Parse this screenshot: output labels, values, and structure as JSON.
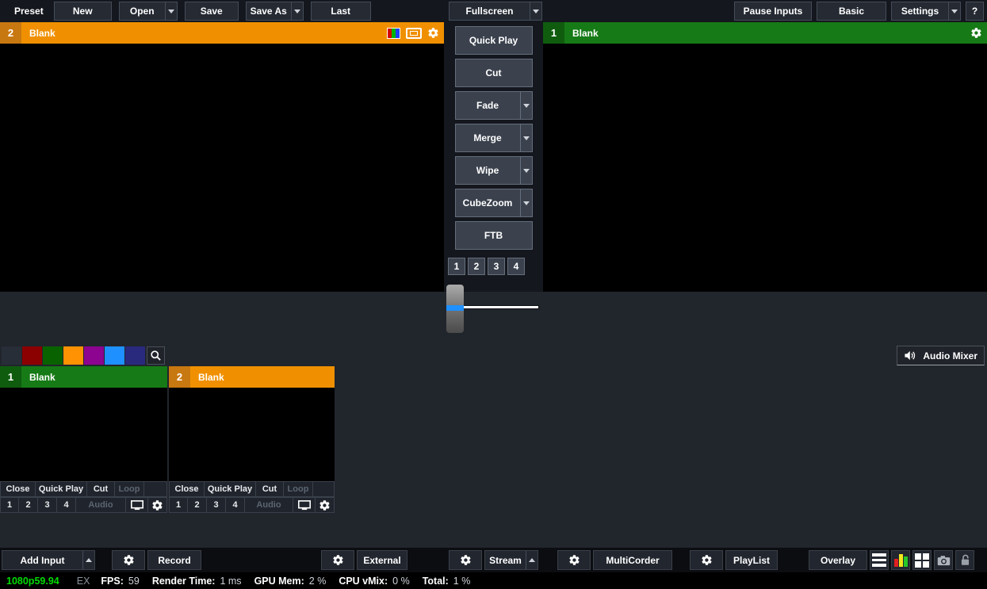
{
  "top_toolbar": {
    "preset_label": "Preset",
    "new": "New",
    "open": "Open",
    "save": "Save",
    "save_as": "Save As",
    "last": "Last",
    "fullscreen": "Fullscreen",
    "pause_inputs": "Pause Inputs",
    "basic": "Basic",
    "settings": "Settings",
    "help": "?"
  },
  "preview": {
    "number": "2",
    "title": "Blank"
  },
  "program": {
    "number": "1",
    "title": "Blank"
  },
  "transitions": {
    "quick_play": "Quick Play",
    "cut": "Cut",
    "fade": "Fade",
    "merge": "Merge",
    "wipe": "Wipe",
    "cube_zoom": "CubeZoom",
    "ftb": "FTB",
    "stingers": [
      "1",
      "2",
      "3",
      "4"
    ]
  },
  "color_filter": {
    "swatches": [
      "#272E37",
      "#8B0000",
      "#096200",
      "#FF9202",
      "#8C0490",
      "#1E90FF",
      "#29297E"
    ]
  },
  "audio_mixer_label": "Audio Mixer",
  "inputs": [
    {
      "number": "1",
      "title": "Blank",
      "close": "Close",
      "quick_play": "Quick Play",
      "cut": "Cut",
      "loop": "Loop",
      "overlays": [
        "1",
        "2",
        "3",
        "4"
      ],
      "audio": "Audio"
    },
    {
      "number": "2",
      "title": "Blank",
      "close": "Close",
      "quick_play": "Quick Play",
      "cut": "Cut",
      "loop": "Loop",
      "overlays": [
        "1",
        "2",
        "3",
        "4"
      ],
      "audio": "Audio"
    }
  ],
  "bottom_toolbar": {
    "add_input": "Add Input",
    "record": "Record",
    "external": "External",
    "stream": "Stream",
    "multicorder": "MultiCorder",
    "playlist": "PlayList",
    "overlay": "Overlay"
  },
  "status_bar": {
    "resolution": "1080p59.94",
    "ex": "EX",
    "fps_label": "FPS:",
    "fps": "59",
    "render_label": "Render Time:",
    "render": "1 ms",
    "gpu_label": "GPU Mem:",
    "gpu": "2 %",
    "cpu_label": "CPU vMix:",
    "cpu": "0 %",
    "total_label": "Total:",
    "total": "1 %"
  },
  "colors": {
    "preview_accent": "#F09000",
    "program_accent": "#167A16",
    "tbar_blue": "#1E90FF",
    "chart_bars": [
      "#E02020",
      "#F2E71D",
      "#28C828"
    ]
  }
}
